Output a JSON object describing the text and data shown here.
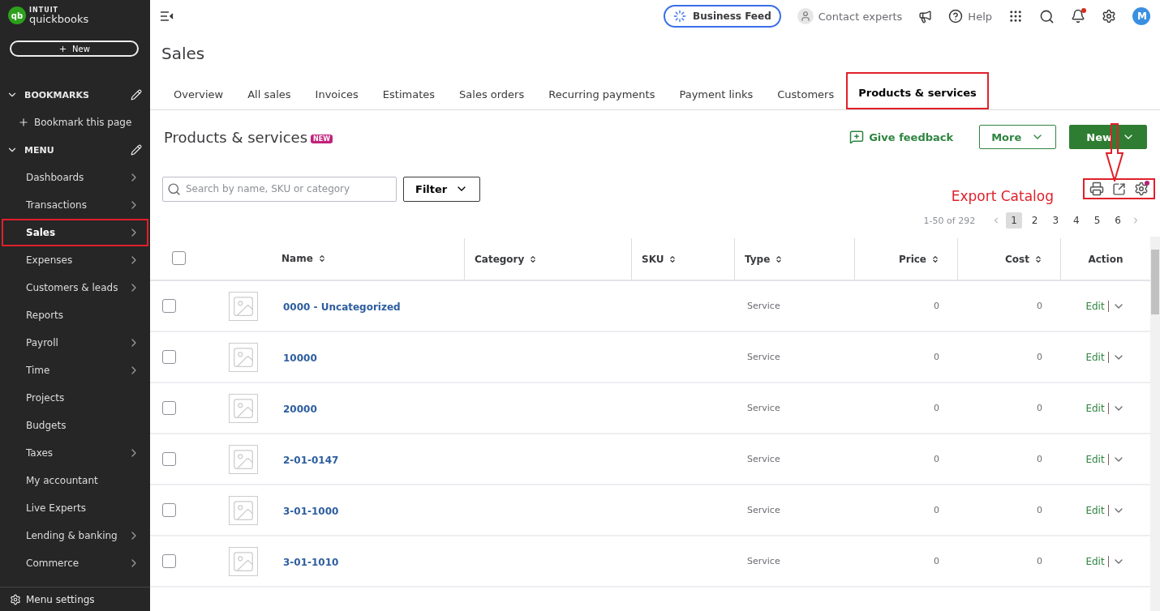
{
  "sidebar": {
    "logo": {
      "mark": "qb",
      "brand": "INTUIT",
      "product": "quickbooks"
    },
    "new_button": "New",
    "bookmarks": {
      "title": "BOOKMARKS",
      "expanded": true,
      "items": [
        "Bookmark this page"
      ]
    },
    "menu": {
      "title": "MENU",
      "expanded": true,
      "items": [
        {
          "label": "Dashboards",
          "has_submenu": true,
          "selected": false,
          "highlighted": false
        },
        {
          "label": "Transactions",
          "has_submenu": true,
          "selected": false,
          "highlighted": false
        },
        {
          "label": "Sales",
          "has_submenu": true,
          "selected": true,
          "highlighted": true
        },
        {
          "label": "Expenses",
          "has_submenu": true,
          "selected": false,
          "highlighted": false
        },
        {
          "label": "Customers & leads",
          "has_submenu": true,
          "selected": false,
          "highlighted": false
        },
        {
          "label": "Reports",
          "has_submenu": false,
          "selected": false,
          "highlighted": false
        },
        {
          "label": "Payroll",
          "has_submenu": true,
          "selected": false,
          "highlighted": false
        },
        {
          "label": "Time",
          "has_submenu": true,
          "selected": false,
          "highlighted": false
        },
        {
          "label": "Projects",
          "has_submenu": false,
          "selected": false,
          "highlighted": false
        },
        {
          "label": "Budgets",
          "has_submenu": false,
          "selected": false,
          "highlighted": false
        },
        {
          "label": "Taxes",
          "has_submenu": true,
          "selected": false,
          "highlighted": false
        },
        {
          "label": "My accountant",
          "has_submenu": false,
          "selected": false,
          "highlighted": false
        },
        {
          "label": "Live Experts",
          "has_submenu": false,
          "selected": false,
          "highlighted": false
        },
        {
          "label": "Lending & banking",
          "has_submenu": true,
          "selected": false,
          "highlighted": false
        },
        {
          "label": "Commerce",
          "has_submenu": true,
          "selected": false,
          "highlighted": false
        }
      ]
    },
    "footer": "Menu settings"
  },
  "top_bar": {
    "business_feed": "Business Feed",
    "contact_experts": "Contact experts",
    "help": "Help",
    "notification_unread": true,
    "avatar_initial": "M"
  },
  "page_title": "Sales",
  "tabs": [
    {
      "label": "Overview",
      "selected": false,
      "highlighted": false
    },
    {
      "label": "All sales",
      "selected": false,
      "highlighted": false
    },
    {
      "label": "Invoices",
      "selected": false,
      "highlighted": false
    },
    {
      "label": "Estimates",
      "selected": false,
      "highlighted": false
    },
    {
      "label": "Sales orders",
      "selected": false,
      "highlighted": false
    },
    {
      "label": "Recurring payments",
      "selected": false,
      "highlighted": false
    },
    {
      "label": "Payment links",
      "selected": false,
      "highlighted": false
    },
    {
      "label": "Customers",
      "selected": false,
      "highlighted": false
    },
    {
      "label": "Products & services",
      "selected": true,
      "highlighted": true
    }
  ],
  "section": {
    "title": "Products & services",
    "badge": "NEW",
    "feedback": "Give feedback",
    "more_button": "More",
    "new_button": "New"
  },
  "search": {
    "placeholder": "Search by name, SKU or category"
  },
  "filter_button": "Filter",
  "annotation": {
    "label": "Export Catalog",
    "icons_highlighted": true
  },
  "settings_has_dot": true,
  "pagination": {
    "range": "1-50 of 292",
    "pages": [
      {
        "label": "1",
        "selected": true
      },
      {
        "label": "2",
        "selected": false
      },
      {
        "label": "3",
        "selected": false
      },
      {
        "label": "4",
        "selected": false
      },
      {
        "label": "5",
        "selected": false
      },
      {
        "label": "6",
        "selected": false
      }
    ]
  },
  "table": {
    "all_checked": false,
    "columns": [
      {
        "label": "Name",
        "sortable": true,
        "kind": "text"
      },
      {
        "label": "Category",
        "sortable": true,
        "kind": "text"
      },
      {
        "label": "SKU",
        "sortable": true,
        "kind": "text"
      },
      {
        "label": "Type",
        "sortable": true,
        "kind": "text"
      },
      {
        "label": "Price",
        "sortable": true,
        "kind": "number"
      },
      {
        "label": "Cost",
        "sortable": true,
        "kind": "number"
      },
      {
        "label": "Action",
        "sortable": false,
        "kind": "action"
      }
    ],
    "rows": [
      {
        "name": "0000 - Uncategorized",
        "type": "Service",
        "price": "0",
        "cost": "0",
        "action": "Edit",
        "checked": false
      },
      {
        "name": "10000",
        "type": "Service",
        "price": "0",
        "cost": "0",
        "action": "Edit",
        "checked": false
      },
      {
        "name": "20000",
        "type": "Service",
        "price": "0",
        "cost": "0",
        "action": "Edit",
        "checked": false
      },
      {
        "name": "2-01-0147",
        "type": "Service",
        "price": "0",
        "cost": "0",
        "action": "Edit",
        "checked": false
      },
      {
        "name": "3-01-1000",
        "type": "Service",
        "price": "0",
        "cost": "0",
        "action": "Edit",
        "checked": false
      },
      {
        "name": "3-01-1010",
        "type": "Service",
        "price": "0",
        "cost": "0",
        "action": "Edit",
        "checked": false
      }
    ]
  }
}
